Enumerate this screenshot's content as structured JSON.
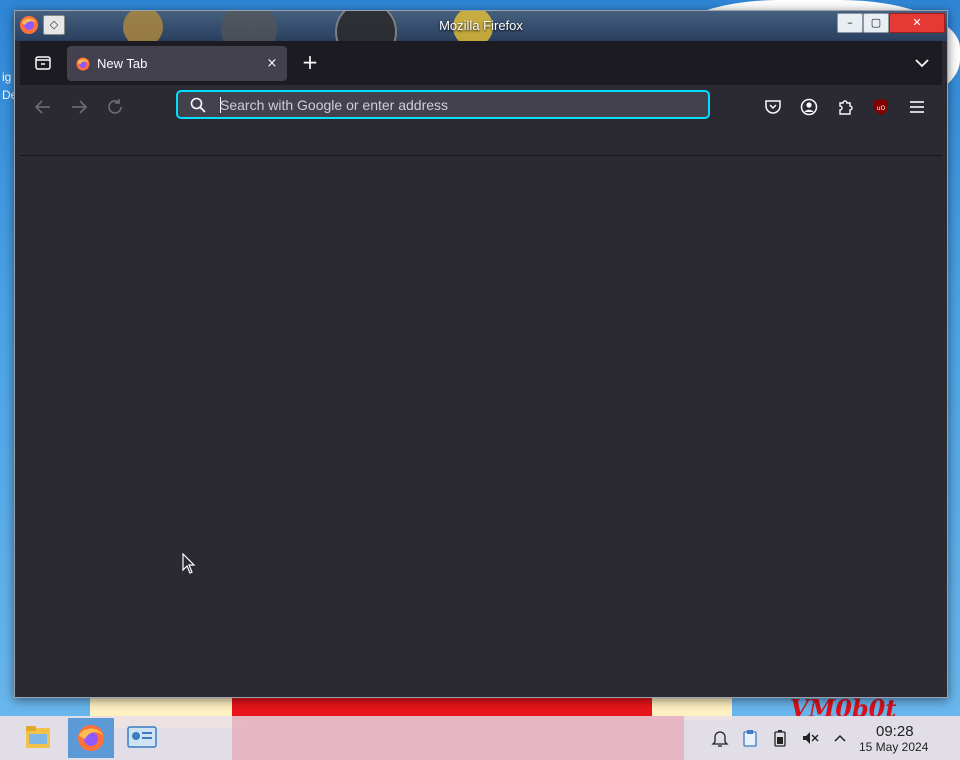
{
  "window": {
    "title": "Mozilla Firefox",
    "minimize_glyph": "–",
    "maximize_glyph": "▢",
    "close_glyph": "✕",
    "pin_glyph": "◇"
  },
  "tabs": [
    {
      "label": "New Tab",
      "active": true,
      "favicon": "firefox-icon"
    }
  ],
  "tab_close_glyph": "×",
  "new_tab_glyph": "+",
  "urlbar": {
    "placeholder": "Search with Google or enter address",
    "value": ""
  },
  "toolbar_icons": [
    "pocket-icon",
    "account-icon",
    "extensions-icon",
    "ublock-icon",
    "menu-icon"
  ],
  "nav_icons": [
    "back-icon",
    "forward-icon",
    "reload-icon"
  ],
  "taskbar": {
    "clock_time": "09:28",
    "clock_date": "15 May 2024",
    "pinned": [
      "file-manager-icon",
      "firefox-icon",
      "system-settings-icon"
    ],
    "tray": [
      "notifications-icon",
      "clipboard-icon",
      "battery-icon",
      "volume-muted-icon",
      "tray-expand-icon"
    ]
  },
  "wallpaper": {
    "fragment_text": "VM0b0t",
    "desktop_label_1": "ig",
    "desktop_label_2": "De"
  },
  "colors": {
    "accent": "#00ddff",
    "toolbar_bg": "#2b2a33",
    "tabstrip_bg": "#1c1b22",
    "tab_bg": "#42414d",
    "text": "#fbfbfe"
  }
}
